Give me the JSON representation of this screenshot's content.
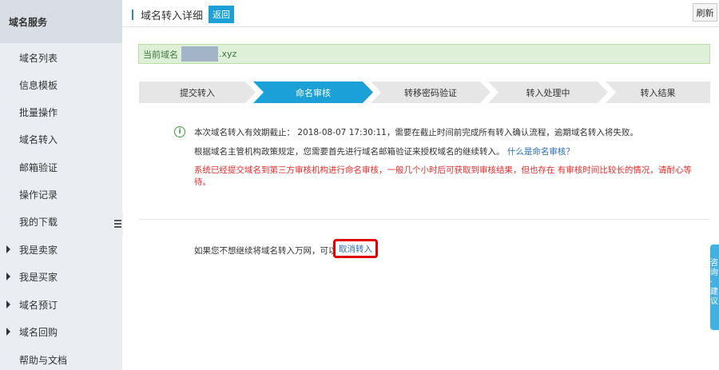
{
  "sidebar": {
    "header": "域名服务",
    "items": [
      {
        "label": "域名列表",
        "expandable": false
      },
      {
        "label": "信息模板",
        "expandable": false
      },
      {
        "label": "批量操作",
        "expandable": false
      },
      {
        "label": "域名转入",
        "expandable": false
      },
      {
        "label": "邮箱验证",
        "expandable": false
      },
      {
        "label": "操作记录",
        "expandable": false
      },
      {
        "label": "我的下载",
        "expandable": false
      },
      {
        "label": "我是卖家",
        "expandable": true
      },
      {
        "label": "我是买家",
        "expandable": true
      },
      {
        "label": "域名预订",
        "expandable": true
      },
      {
        "label": "域名回购",
        "expandable": true
      },
      {
        "label": "帮助与文档",
        "expandable": false
      }
    ]
  },
  "header": {
    "title": "域名转入详细",
    "back_label": "返回",
    "refresh_label": "刷新"
  },
  "domain_bar": {
    "prefix": "当前域名",
    "suffix": ".xyz"
  },
  "steps": {
    "items": [
      "提交转入",
      "命名审核",
      "转移密码验证",
      "转入处理中",
      "转入结果"
    ],
    "active_index": 1
  },
  "info": {
    "line1": "本次域名转入有效期截止：  2018-08-07 17:30:11，需要在截止时间前完成所有转入确认流程，逾期域名转入将失败。",
    "line2": "根据域名主管机构政策规定，您需要首先进行域名邮箱验证来授权域名的继续转入。",
    "link": "什么是命名审核？",
    "warning": "系统已经提交域名到第三方审核机构进行命名审核，一般几个小时后可获取到审核结果，但也存在 有审核时间比较长的情况，请耐心等待。"
  },
  "cancel": {
    "text": "如果您不想继续将域名转入万网，可以",
    "link": "取消转入"
  },
  "feedback": {
    "label": "咨询·建议"
  },
  "colors": {
    "accent": "#1ba1d8",
    "step_inactive": "#e6e6e6",
    "warning": "#e52c2c",
    "link": "#2a6ebb",
    "success_bg": "#dff0d8"
  }
}
